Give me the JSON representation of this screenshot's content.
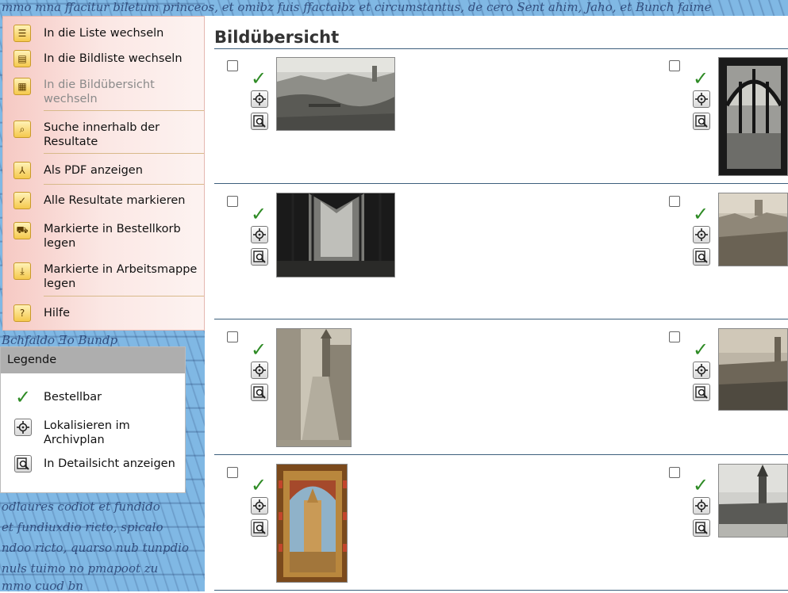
{
  "background_script": [
    "mmo mna ffacitur biletum princeos, et omibz fuis ffactaibz et circumstantus, de cero Sent ahim, Jaho, et Bunch faime",
    "Bchfaldo Ǝo Bundp",
    "odlaures codiot et fundido",
    "et fundiuxdio ricto, spicalo",
    "ndoo ricto, quarso nub tunpdio",
    "nuls tuimo no pmapoot zu",
    "mmo cuod bn"
  ],
  "menu": {
    "items": [
      {
        "label": "In die Liste wechseln",
        "icon": "list-icon",
        "glyph": "☰",
        "disabled": false
      },
      {
        "label": "In die Bildliste wechseln",
        "icon": "image-list-icon",
        "glyph": "▤",
        "disabled": false
      },
      {
        "label": "In die Bildübersicht wechseln",
        "label_lines": [
          "In die Bildübersicht",
          "wechseln"
        ],
        "icon": "grid-icon",
        "glyph": "▦",
        "disabled": true
      },
      {
        "label_lines": [
          "Suche innerhalb der",
          "Resultate"
        ],
        "icon": "search-results-icon",
        "glyph": "⌕",
        "disabled": false
      },
      {
        "label": "Als PDF anzeigen",
        "icon": "pdf-icon",
        "glyph": "⅄",
        "disabled": false
      },
      {
        "label": "Alle Resultate markieren",
        "icon": "checkmark-icon",
        "glyph": "✓",
        "disabled": false
      },
      {
        "label_lines": [
          "Markierte in Bestellkorb",
          "legen"
        ],
        "icon": "cart-icon",
        "glyph": "⛟",
        "disabled": false
      },
      {
        "label_lines": [
          "Markierte in Arbeitsmappe",
          "legen"
        ],
        "icon": "folder-icon",
        "glyph": "⤓",
        "disabled": false
      },
      {
        "label": "Hilfe",
        "icon": "help-icon",
        "glyph": "?",
        "disabled": false
      }
    ]
  },
  "legend": {
    "title": "Legende",
    "items": [
      {
        "label_lines": [
          "Bestellbar"
        ],
        "icon": "orderable-check-icon"
      },
      {
        "label_lines": [
          "Lokalisieren im",
          "Archivplan"
        ],
        "icon": "locate-icon"
      },
      {
        "label_lines": [
          "In Detailsicht anzeigen"
        ],
        "icon": "detail-view-icon"
      }
    ]
  },
  "main": {
    "title": "Bildübersicht",
    "rows": [
      {
        "left": {
          "thumb": "city-panorama"
        },
        "right": {
          "thumb": "gothic-window"
        }
      },
      {
        "left": {
          "thumb": "church-interior"
        },
        "right": {
          "thumb": "city-rooftops"
        }
      },
      {
        "left": {
          "thumb": "street-tower"
        },
        "right": {
          "thumb": "city-view-tower"
        }
      },
      {
        "left": {
          "thumb": "painted-cathedral"
        },
        "right": {
          "thumb": "cathedral-square"
        }
      }
    ]
  },
  "colors": {
    "background_blue": "#80b8e4",
    "menu_pink": "#f6c9c3",
    "rule": "#3d5f7c",
    "checkmark_green": "#2e8b25"
  }
}
